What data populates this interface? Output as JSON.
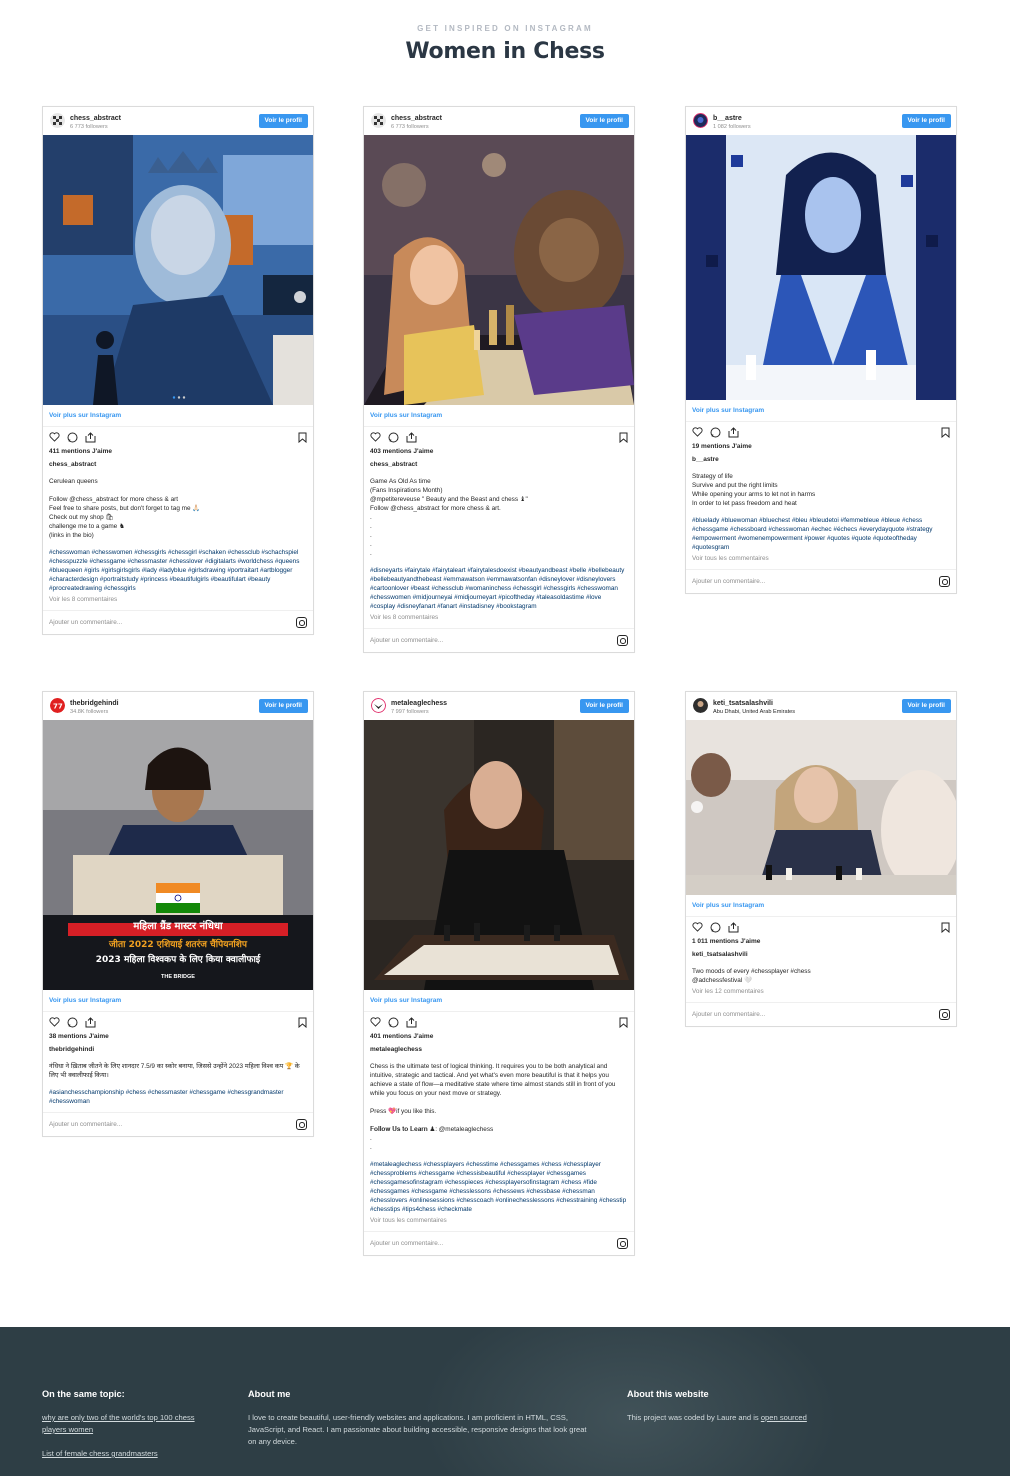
{
  "header": {
    "eyebrow": "GET INSPIRED ON INSTAGRAM",
    "title": "Women in Chess"
  },
  "ui": {
    "view_profile": "Voir le profil",
    "see_more": "Voir plus sur Instagram",
    "add_comment": "Ajouter un commentaire..."
  },
  "cards": [
    {
      "username": "chess_abstract",
      "followers": "6 773 followers",
      "likes": "411 mentions J'aime",
      "caption": "Cerulean queens\n\nFollow @chess_abstract for more chess & art\nFeel free to share posts, but don't forget to tag me 🙏🏻\nCheck out my shop 🛍\nchallenge me to a game ♞\n(links in the bio)",
      "hashtags": "#chesswoman #chesswomen #chessgirls #chessgirl #schaken #chessclub #schachspiel #chesspuzzle #chessgame #chessmaster #chesslover #digitalarts #worldchess #queens #bluequeen #girls #girlsgirlsgirls #lady #ladyblue #girlsdrawing #portraitart #artblogger #characterdesign #portraitstudy #princess #beautifulgirls #beautifulart #beauty #procreatedrawing #chessgirls",
      "comments": "Voir les 8 commentaires"
    },
    {
      "username": "chess_abstract",
      "followers": "6 773 followers",
      "likes": "403 mentions J'aime",
      "caption": "Game As Old As time\n(Fans Inspirations Month)\n@mpetitereveuse \" Beauty and the Beast and chess ♝\"\nFollow @chess_abstract for more chess & art.\n.\n.\n.\n.\n.",
      "hashtags": "#disneyarts #fairytale #fairytaleart #fairytalesdoexist #beautyandbeast #belle #bellebeauty #bellebeautyandthebeast #emmawatson #emmawatsonfan #disneylover #disneylovers #cartoonlover #beast #chessclub #womaninchess #chessgirl #chessgirls #chesswoman #chesswomen #midjourneyai #midjourneyart #picoftheday #taleasoldastime #love #cosplay #disneyfanart #fanart #instadisney #bookstagram",
      "comments": "Voir les 8 commentaires"
    },
    {
      "username": "b__astre",
      "followers": "1 082 followers",
      "likes": "19 mentions J'aime",
      "caption": "Strategy of life\nSurvive and put the right limits\nWhile opening your arms to let not in harms\nIn order to let pass freedom and heat",
      "hashtags": "#bluelady #bluewoman #bluechest #bleu #bleudetoi #femmebleue #bleue #chess #chessgame #chessboard #chesswoman #echec #échecs #everydayquote #strategy #empowerment #womenempowerment #power #quotes #quote #quoteoftheday #quotesgram",
      "comments": "Voir tous les commentaires"
    },
    {
      "username": "thebridgehindi",
      "followers": "34.8K followers",
      "likes": "38 mentions J'aime",
      "caption": "नंधिधा ने ख़िताब जीतने के लिए शानदार 7.5/9 का स्कोर बनाया, जिससे उन्होंने 2023 महिला विश्व कप 🏆 के लिए भी क्वालीफाई किया।",
      "hashtags": "#asianchesschampionship #chess #chessmaster #chessgame #chessgrandmaster #chesswoman",
      "comments": "",
      "overlay": {
        "line1": "महिला ग्रैंड मास्टर नंधिधा",
        "line2": "जीता 2022 एशियाई शतरंज चैंपियनशिप",
        "line3": "2023 महिला विश्वकप के लिए किया क्वालीफाई",
        "brand": "THE BRIDGE"
      }
    },
    {
      "username": "metaleaglechess",
      "followers": "7 997 followers",
      "likes": "401 mentions J'aime",
      "caption": "Chess is the ultimate test of logical thinking. It requires you to be both analytical and intuitive, strategic and tactical. And yet what's even more beautiful is that it helps you achieve a state of flow—a meditative state where time almost stands still in front of you while you focus on your next move or strategy.\n\nPress 💖if you like this.\n\n𝐅𝐨𝐥𝐥𝐨𝐰 𝐔𝐬 𝐭𝐨 𝐋𝐞𝐚𝐫𝐧 ♟: @metaleaglechess\n.\n.",
      "hashtags": "#metaleaglechess #chessplayers #chesstime #chessgames #chess #chessplayer #chessproblems #chessgame #chessisbeautiful #chessplayer #chessgames #chessgamesofinstagram #chesspieces #chessplayersofinstagram #chess #fide #chessgames #chessgame #chesslessons #chessews #chessbase #chessman #chesslovers #onlinesessions #chesscoach #onlinechesslessons #chesstraining #chesstip #chesstips #tips4chess #checkmate",
      "comments": "Voir tous les commentaires"
    },
    {
      "username": "keti_tsatsalashvili",
      "followers": "Abu Dhabi, United Arab Emirates",
      "likes": "1 011 mentions J'aime",
      "caption": "Two moods of every #chessplayer #chess\n@adchessfestival 🤍",
      "hashtags": "",
      "comments": "Voir les 12 commentaires"
    }
  ],
  "footer": {
    "topic_title": "On the same topic:",
    "topic_link1": "why are only two of the world's top 100 chess players women",
    "topic_link2": "List of female chess grandmasters",
    "about_title": "About me",
    "about_text": "I love to create beautiful, user-friendly websites and applications. I am proficient in HTML, CSS, JavaScript, and React. I am passionate about building accessible, responsive designs that look great on any device.",
    "site_title": "About this website",
    "site_text": "This project was coded by Laure and is",
    "site_link": "open sourced"
  }
}
